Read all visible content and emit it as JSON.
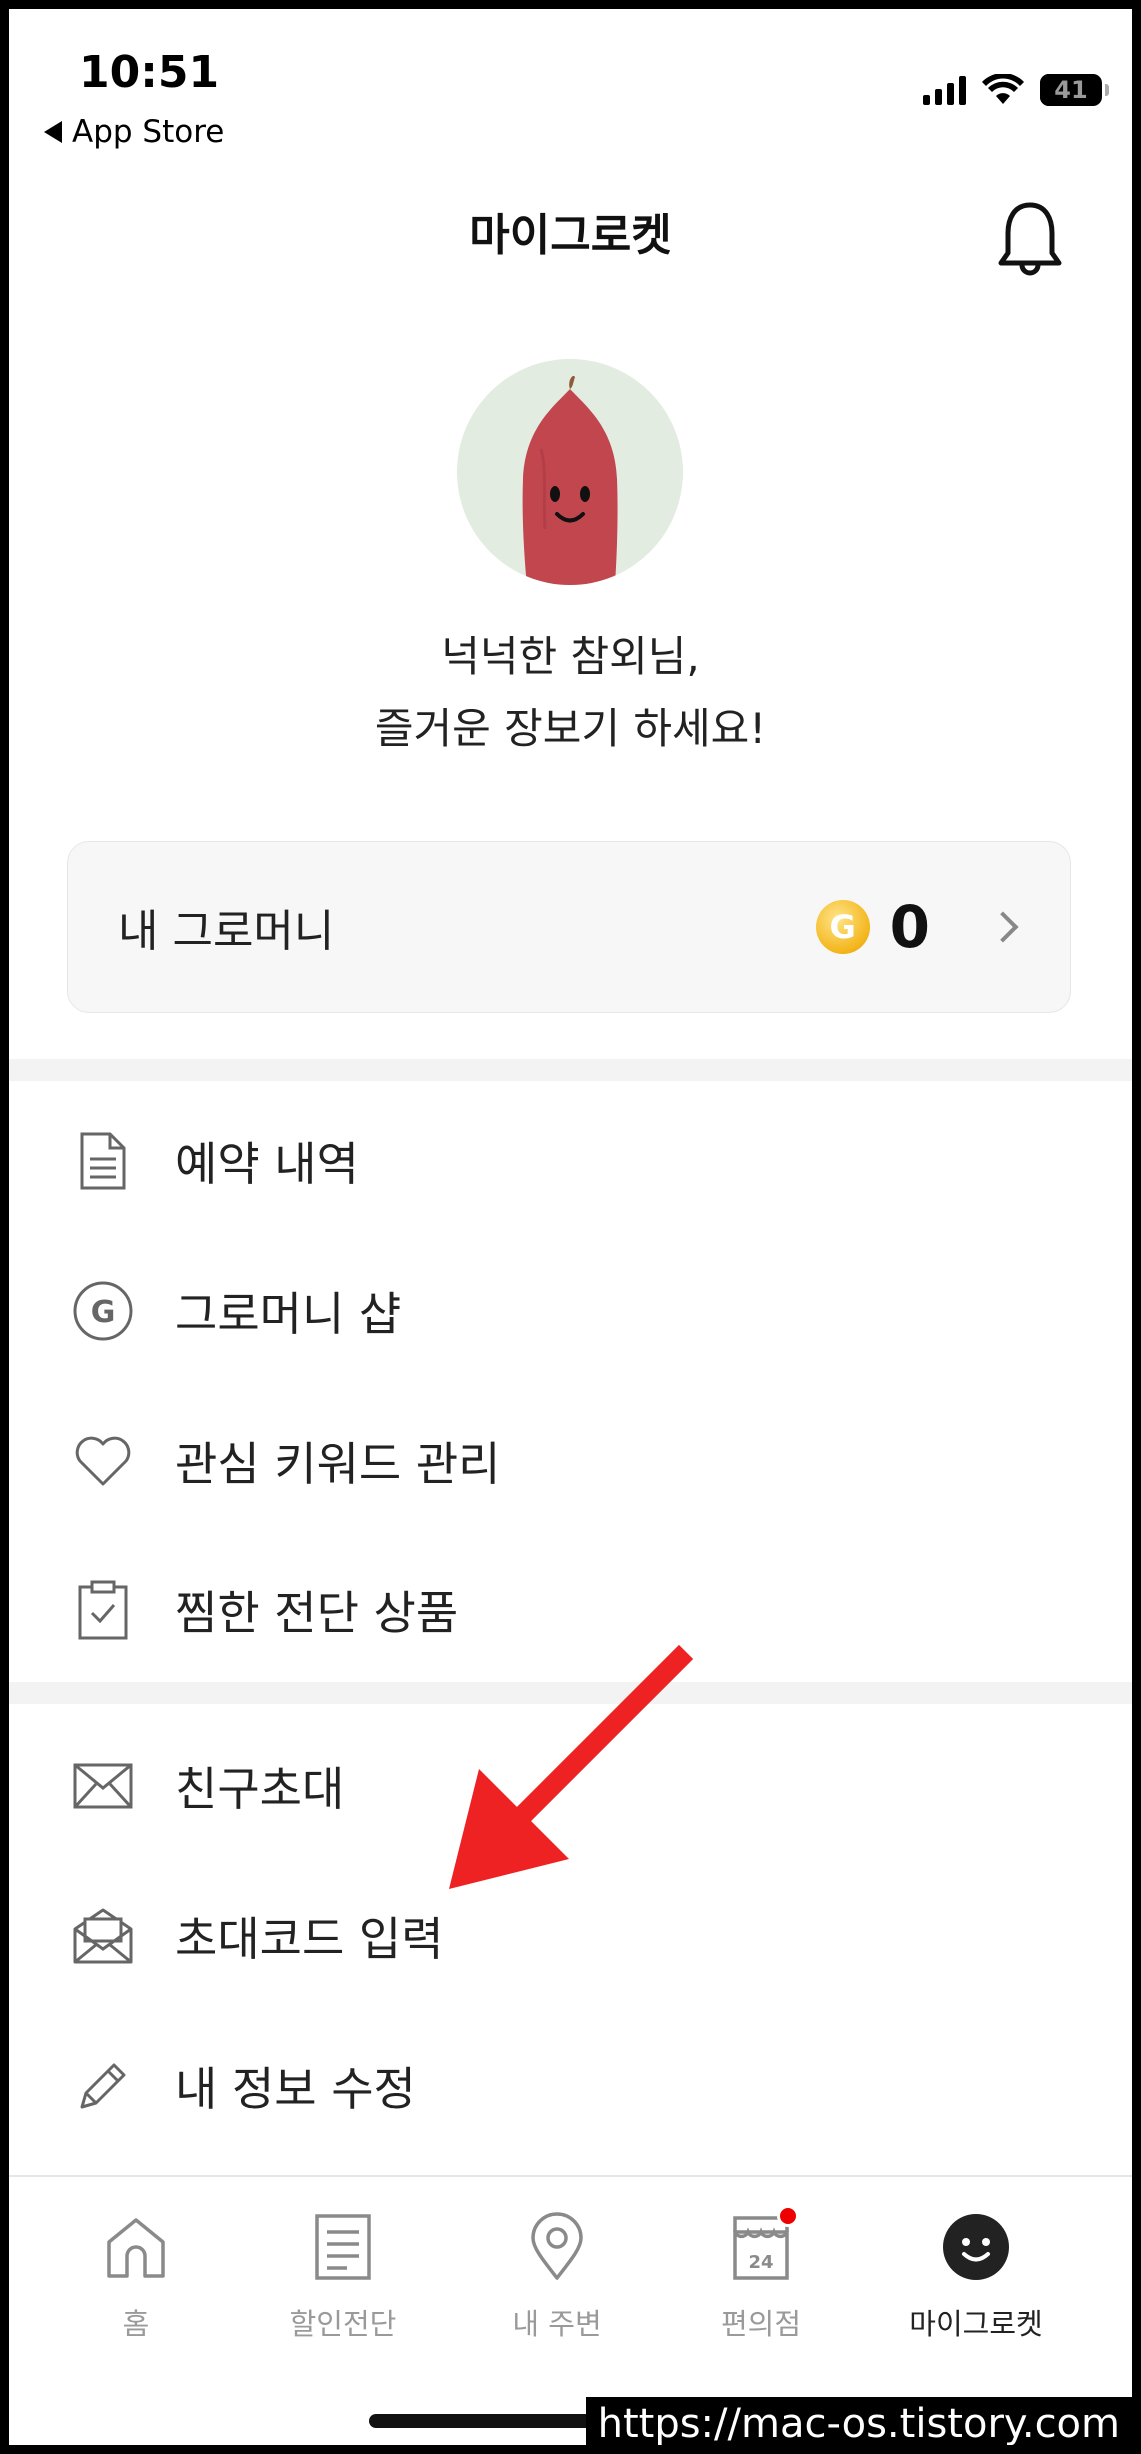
{
  "status_bar": {
    "time": "10:51",
    "back_label": "App Store",
    "battery": "41",
    "battery_fraction": 0.41
  },
  "header": {
    "title": "마이그로켓"
  },
  "profile": {
    "greeting_line1": "넉넉한 참외님,",
    "greeting_line2": "즐거운 장보기 하세요!"
  },
  "money": {
    "label": "내 그로머니",
    "coin_letter": "G",
    "value": "0"
  },
  "menu_group1": [
    {
      "label": "예약 내역",
      "icon": "document-icon"
    },
    {
      "label": "그로머니 샵",
      "icon": "g-coin-icon"
    },
    {
      "label": "관심 키워드 관리",
      "icon": "heart-icon"
    },
    {
      "label": "찜한 전단 상품",
      "icon": "clipboard-check-icon"
    }
  ],
  "menu_group2": [
    {
      "label": "친구초대",
      "icon": "envelope-icon"
    },
    {
      "label": "초대코드 입력",
      "icon": "open-envelope-icon"
    },
    {
      "label": "내 정보 수정",
      "icon": "pencil-icon"
    }
  ],
  "tabs": [
    {
      "label": "홈",
      "icon": "home-icon"
    },
    {
      "label": "할인전단",
      "icon": "flyer-icon"
    },
    {
      "label": "내 주변",
      "icon": "location-pin-icon"
    },
    {
      "label": "편의점",
      "icon": "store-icon",
      "badge_text": "24"
    },
    {
      "label": "마이그로켓",
      "icon": "smiley-icon"
    }
  ],
  "watermark": "https://mac-os.tistory.com",
  "colors": {
    "accent_red": "#ee2222",
    "coin_gold": "#f3b51b",
    "badge_red": "#dd0000"
  }
}
